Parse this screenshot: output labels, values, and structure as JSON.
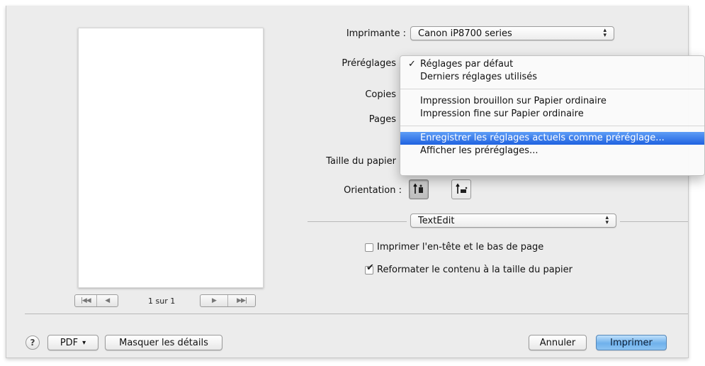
{
  "preview": {
    "page_count": "1 sur 1",
    "nav_first": "|◀◀",
    "nav_prev": "◀",
    "nav_next": "▶",
    "nav_last": "▶▶|"
  },
  "printer": {
    "label": "Imprimante :",
    "value": "Canon iP8700 series"
  },
  "presets": {
    "label": "Préréglages",
    "menu": {
      "checkmark": "✓",
      "items": [
        "Réglages par défaut",
        "Derniers réglages utilisés",
        "Impression brouillon sur Papier ordinaire",
        "Impression fine sur Papier ordinaire",
        "Enregistrer les réglages actuels comme préréglage...",
        "Afficher les préréglages..."
      ]
    }
  },
  "copies": {
    "label": "Copies"
  },
  "pages": {
    "label": "Pages"
  },
  "paper_size": {
    "label": "Taille du papier"
  },
  "orientation": {
    "label": "Orientation :"
  },
  "app_section": {
    "value": "TextEdit"
  },
  "options": {
    "header_footer": {
      "label": "Imprimer l'en-tête et le bas de page",
      "checked": false
    },
    "rewrap": {
      "label": "Reformater le contenu à la taille du papier",
      "checked": true,
      "mark": "✔"
    }
  },
  "footer": {
    "help": "?",
    "pdf": "PDF",
    "pdf_arrow": "▾",
    "hide_details": "Masquer les détails",
    "cancel": "Annuler",
    "print": "Imprimer"
  },
  "colors": {
    "sheet_bg": "#ececec",
    "menu_highlight": "#2a6fe6",
    "primary_button": "#6fb1ec"
  }
}
